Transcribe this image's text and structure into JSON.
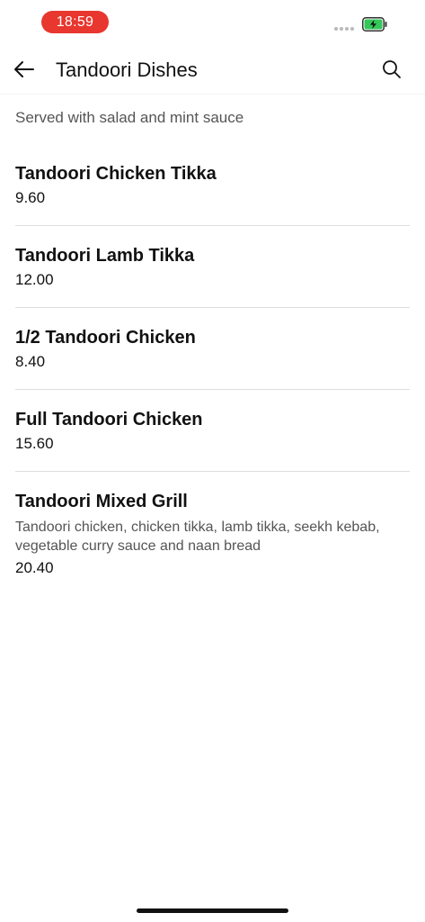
{
  "status_bar": {
    "time": "18:59",
    "battery_color": "#34c759",
    "time_pill_color": "#e8372e"
  },
  "header": {
    "title": "Tandoori Dishes",
    "back_icon": "arrow-left-icon",
    "search_icon": "search-icon"
  },
  "subtitle": "Served with salad and mint sauce",
  "items": [
    {
      "name": "Tandoori Chicken Tikka",
      "description": "",
      "price": "9.60"
    },
    {
      "name": "Tandoori Lamb Tikka",
      "description": "",
      "price": "12.00"
    },
    {
      "name": "1/2 Tandoori Chicken",
      "description": "",
      "price": "8.40"
    },
    {
      "name": "Full Tandoori Chicken",
      "description": "",
      "price": "15.60"
    },
    {
      "name": "Tandoori Mixed Grill",
      "description": "Tandoori chicken, chicken tikka, lamb tikka, seekh kebab, vegetable curry sauce and naan bread",
      "price": "20.40"
    }
  ]
}
